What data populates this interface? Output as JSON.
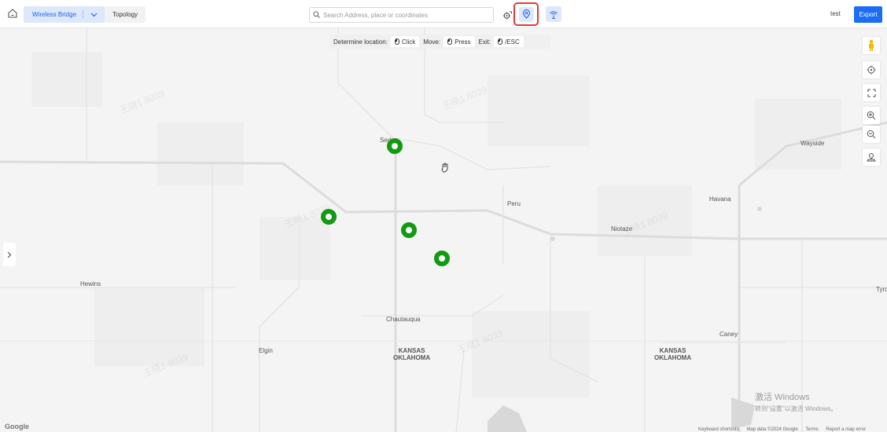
{
  "header": {
    "tabs": [
      {
        "label": "Wireless Bridge",
        "active": true
      },
      {
        "label": "Topology",
        "active": false
      }
    ],
    "search": {
      "placeholder": "Search Address, place or coordinates",
      "value": ""
    },
    "tools": {
      "settings_icon": "route-settings-icon",
      "locate_icon": "location-pin-icon",
      "bridge_icon": "wireless-bridge-icon"
    },
    "user": "test",
    "export_label": "Export"
  },
  "hint": {
    "determine_label": "Determine location:",
    "determine_key": "Click",
    "move_label": "Move:",
    "move_key": "Press",
    "exit_label": "Exit:",
    "exit_key": "/ESC"
  },
  "map": {
    "places": [
      "Sedan",
      "Peru",
      "Havana",
      "Wayside",
      "Niotaze",
      "Hewins",
      "Chautauqua",
      "Elgin",
      "Caney",
      "Tyro"
    ],
    "state_labels": [
      {
        "line1": "KANSAS",
        "line2": "OKLAHOMA"
      },
      {
        "line1": "KANSAS",
        "line2": "OKLAHOMA"
      }
    ],
    "marker_color": "#129a12",
    "marker_count": 4,
    "watermark_text": "王晓1 8039",
    "windows_activation": {
      "line1": "激活 Windows",
      "line2": "转到\"设置\"以激活 Windows。"
    },
    "google_logo": "Google",
    "footer": [
      "Keyboard shortcuts",
      "Map data ©2024 Google",
      "Terms",
      "Report a map error"
    ]
  },
  "colors": {
    "accent": "#1b6ef3",
    "highlight": "#e53935",
    "active_tab_bg": "#dde8fb"
  }
}
